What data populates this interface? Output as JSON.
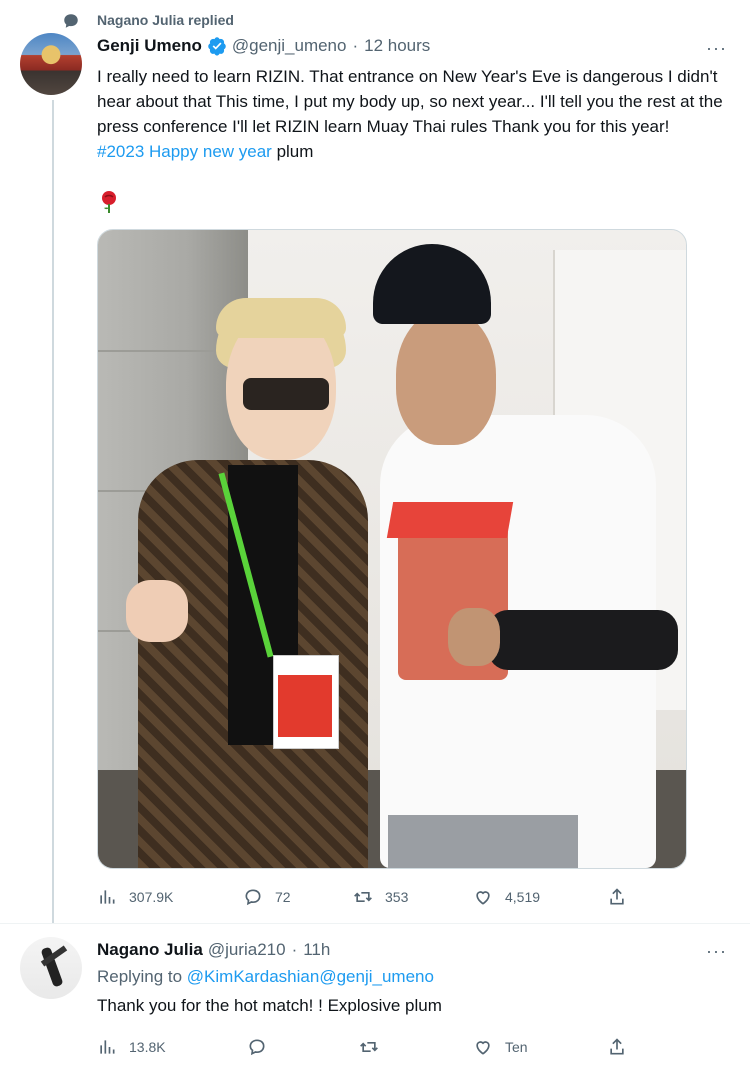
{
  "context": {
    "replied_label": "Nagano Julia replied"
  },
  "tweet": {
    "author_name": "Genji Umeno",
    "handle": "@genji_umeno",
    "separator": "·",
    "time": "12 hours",
    "more": "···",
    "text": "I really need to learn RIZIN. That entrance on New Year's Eve is dangerous I didn't hear about that This time, I put my body up, so next year... I'll tell you the rest at the press conference I'll let RIZIN learn Muay Thai rules Thank you for this year!",
    "hashtag": "#2023 Happy new year",
    "hashtag_suffix": " plum",
    "emoji_icon": "rose-icon",
    "stats": {
      "views": "307.9K",
      "replies": "72",
      "retweets": "353",
      "likes": "4,519"
    }
  },
  "reply": {
    "author_name": "Nagano Julia",
    "handle": "@juria210",
    "separator": "·",
    "time": "11h",
    "more": "···",
    "replying_prefix": "Replying to ",
    "replying_to_1": "@KimKardashian",
    "replying_to_2": "@genji_umeno",
    "text": "Thank you for the hot match! ! Explosive plum",
    "stats": {
      "views": "13.8K",
      "replies": "",
      "retweets": "",
      "likes": "Ten"
    }
  },
  "colors": {
    "accent": "#1d9bf0",
    "muted": "#536471",
    "text": "#0f1419",
    "verified": "#1d9bf0"
  }
}
